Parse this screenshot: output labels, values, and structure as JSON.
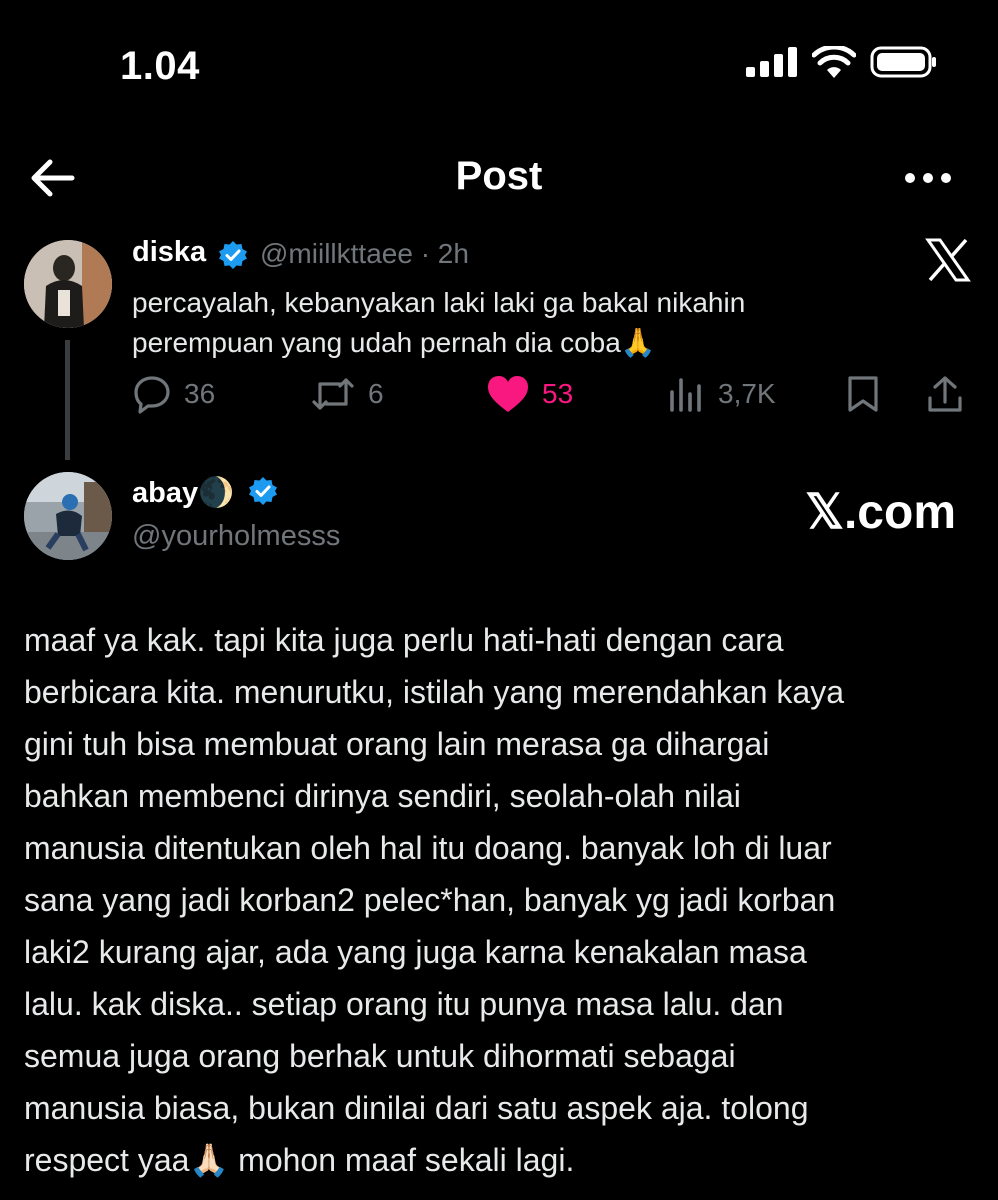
{
  "status_bar": {
    "time": "1.04"
  },
  "header": {
    "title": "Post"
  },
  "original_tweet": {
    "name": "diska",
    "handle": "@miillkttaee",
    "separator": "·",
    "age": "2h",
    "text_line1": "percayalah, kebanyakan laki laki ga bakal nikahin",
    "text_line2": "perempuan yang udah pernah dia coba",
    "emoji_end": "🙏",
    "stats": {
      "replies": "36",
      "reposts": "6",
      "likes": "53",
      "views": "3,7K"
    },
    "like_color": "#f91880"
  },
  "reply_tweet": {
    "name": "abay",
    "name_emoji": "🌒",
    "handle": "@yourholmesss",
    "brand_mark": "𝕏",
    "brand_suffix": ".com",
    "lines": [
      "maaf ya kak. tapi kita juga perlu hati-hati dengan cara",
      "berbicara kita. menurutku, istilah yang merendahkan kaya",
      "gini tuh bisa membuat orang lain merasa ga dihargai",
      "bahkan membenci dirinya sendiri, seolah-olah nilai",
      "manusia ditentukan oleh hal itu doang. banyak loh di luar",
      "sana yang jadi korban2 pelec*han, banyak yg jadi korban",
      "laki2 kurang ajar, ada yang juga karna kenakalan masa",
      "lalu. kak diska.. setiap orang itu punya masa lalu. dan",
      "semua juga orang berhak untuk dihormati sebagai",
      "manusia biasa, bukan dinilai dari satu aspek aja. tolong"
    ],
    "last_line_start": "respect yaa",
    "last_line_emoji": "🙏🏻",
    "last_line_end": " mohon maaf sekali lagi."
  },
  "colors": {
    "verified": "#1d9bf0",
    "muted": "#71767b",
    "background": "#000000"
  }
}
